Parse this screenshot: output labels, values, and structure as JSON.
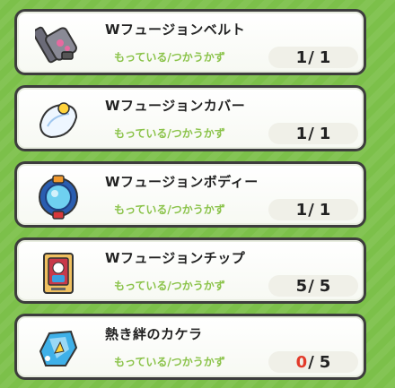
{
  "owned_label": "もっている/つかうかず",
  "items": [
    {
      "name": "Wフュージョンベルト",
      "have": "1",
      "sep": "/",
      "need": "1",
      "icon": "belt-icon",
      "zero": false
    },
    {
      "name": "Wフュージョンカバー",
      "have": "1",
      "sep": "/",
      "need": "1",
      "icon": "cover-icon",
      "zero": false
    },
    {
      "name": "Wフュージョンボディー",
      "have": "1",
      "sep": "/",
      "need": "1",
      "icon": "body-icon",
      "zero": false
    },
    {
      "name": "Wフュージョンチップ",
      "have": "5",
      "sep": "/",
      "need": "5",
      "icon": "chip-icon",
      "zero": false
    },
    {
      "name": "熱き絆のカケラ",
      "have": "0",
      "sep": "/",
      "need": "5",
      "icon": "fragment-icon",
      "zero": true
    }
  ],
  "colors": {
    "label_green": "#8bc34a",
    "zero_red": "#e23a2a",
    "frame": "#3d3d3d",
    "background": "#7cc04a"
  }
}
